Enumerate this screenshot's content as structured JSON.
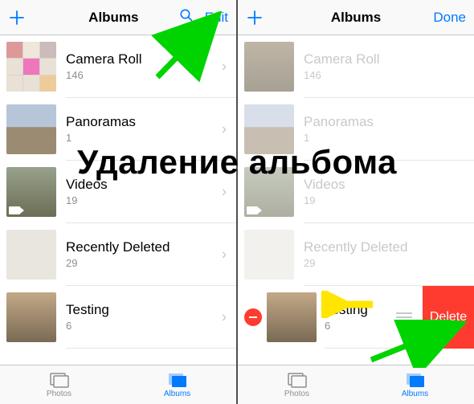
{
  "caption": "Удаление альбома",
  "left": {
    "nav": {
      "title": "Albums",
      "right": "Edit"
    },
    "albums": [
      {
        "name": "Camera Roll",
        "count": "146"
      },
      {
        "name": "Panoramas",
        "count": "1"
      },
      {
        "name": "Videos",
        "count": "19"
      },
      {
        "name": "Recently Deleted",
        "count": "29"
      },
      {
        "name": "Testing",
        "count": "6"
      }
    ],
    "tabs": {
      "photos": "Photos",
      "albums": "Albums"
    }
  },
  "right": {
    "nav": {
      "title": "Albums",
      "right": "Done"
    },
    "albums": [
      {
        "name": "Camera Roll",
        "count": "146"
      },
      {
        "name": "Panoramas",
        "count": "1"
      },
      {
        "name": "Videos",
        "count": "19"
      },
      {
        "name": "Recently Deleted",
        "count": "29"
      },
      {
        "name": "Testing",
        "count": "6"
      }
    ],
    "delete_label": "Delete",
    "tabs": {
      "photos": "Photos",
      "albums": "Albums"
    }
  }
}
